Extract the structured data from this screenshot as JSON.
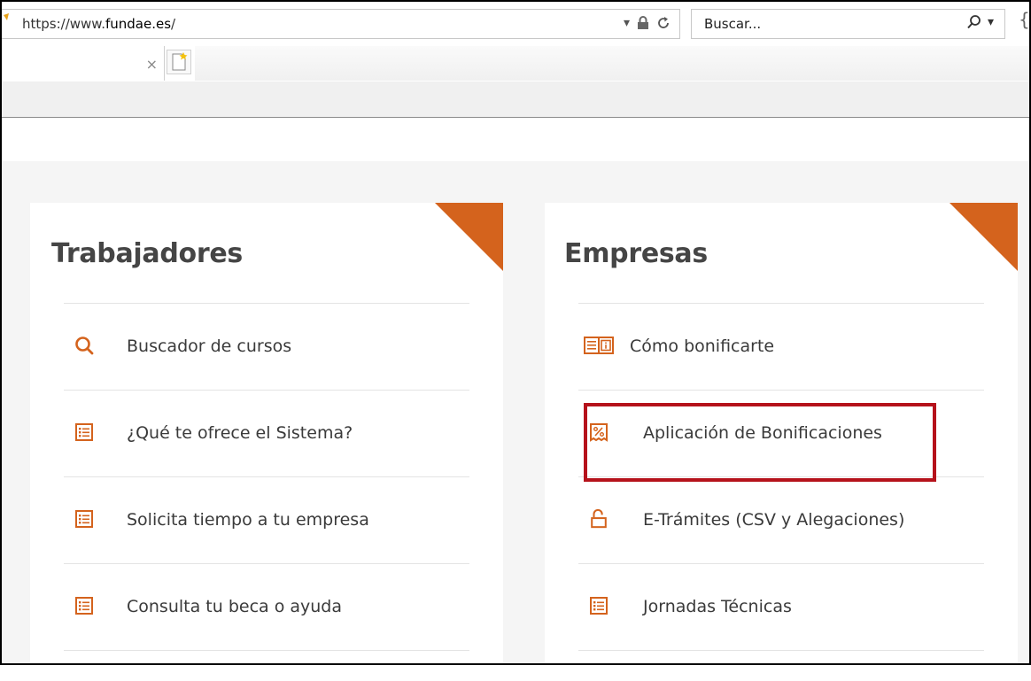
{
  "browser": {
    "url_prefix": "https://www.",
    "url_domain": "fundae.es",
    "url_suffix": "/",
    "search_placeholder": "Buscar..."
  },
  "sections": {
    "trabajadores": {
      "title": "Trabajadores",
      "items": [
        {
          "label": "Buscador de cursos",
          "icon": "search-icon"
        },
        {
          "label": "¿Qué te ofrece el Sistema?",
          "icon": "list-icon"
        },
        {
          "label": "Solicita tiempo a tu empresa",
          "icon": "list-icon"
        },
        {
          "label": "Consulta tu beca o ayuda",
          "icon": "list-icon"
        }
      ]
    },
    "empresas": {
      "title": "Empresas",
      "items": [
        {
          "label": "Cómo bonificarte",
          "icon": "document-info-icon"
        },
        {
          "label": "Aplicación de Bonificaciones",
          "icon": "percent-icon"
        },
        {
          "label": "E-Trámites (CSV y Alegaciones)",
          "icon": "unlock-icon"
        },
        {
          "label": "Jornadas Técnicas",
          "icon": "list-icon"
        }
      ]
    }
  },
  "colors": {
    "accent": "#d4631d",
    "highlight": "#b5121b"
  }
}
